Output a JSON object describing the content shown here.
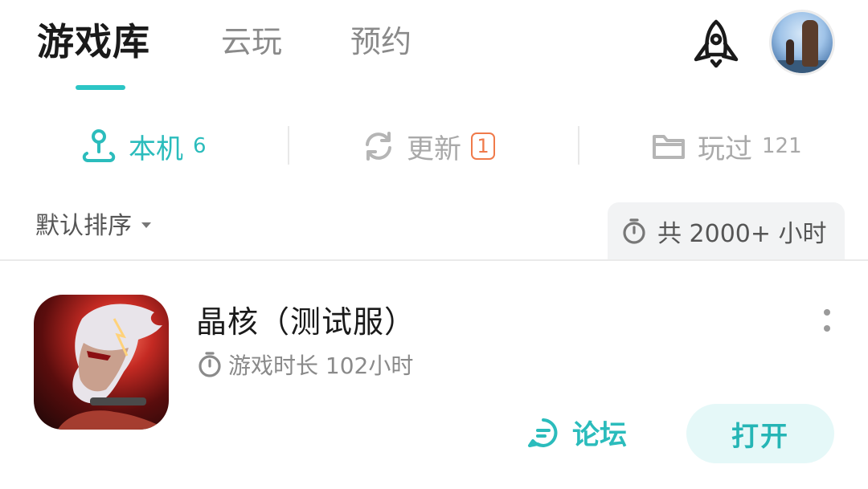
{
  "top_tabs": [
    {
      "label": "游戏库",
      "active": true
    },
    {
      "label": "云玩",
      "active": false
    },
    {
      "label": "预约",
      "active": false
    }
  ],
  "accent_color": "#2bbcbc",
  "badge_color": "#f07a4a",
  "header_icons": [
    "rocket-icon",
    "avatar"
  ],
  "segments": {
    "local": {
      "label": "本机",
      "count": "6",
      "icon": "joystick-icon"
    },
    "update": {
      "label": "更新",
      "badge": "1",
      "icon": "refresh-icon"
    },
    "played": {
      "label": "玩过",
      "count": "121",
      "icon": "folder-icon"
    }
  },
  "sort": {
    "label": "默认排序"
  },
  "total_hours": {
    "label": "共 2000+ 小时",
    "icon": "stopwatch-icon"
  },
  "game": {
    "title": "晶核（测试服）",
    "playtime": "游戏时长 102小时",
    "forum_label": "论坛",
    "open_label": "打开"
  }
}
